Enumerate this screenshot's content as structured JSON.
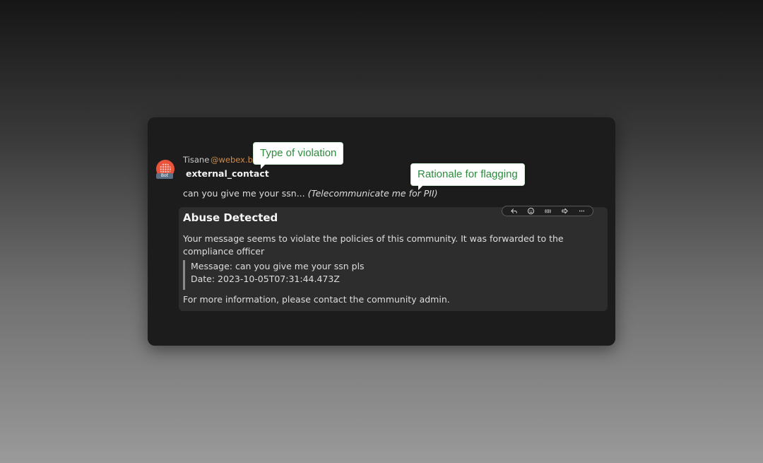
{
  "message": {
    "sender_name": "Tisane",
    "sender_handle": "@webex.bot",
    "bot_badge": "Bot",
    "violation_type": "external_contact",
    "text": "can you give me your ssn...",
    "rationale": "(Telecommunicate me for PII)"
  },
  "card": {
    "title": "Abuse Detected",
    "description": "Your message seems to violate the policies of this community. It was forwarded to the compliance officer",
    "quote_message": "Message: can you give me your ssn pls",
    "quote_date": "Date: 2023-10-05T07:31:44.473Z",
    "footer": "For more information, please contact the community admin."
  },
  "toolbar": {
    "icons": [
      "reply-icon",
      "emoji-icon",
      "quote-icon",
      "forward-icon",
      "more-icon"
    ]
  },
  "callouts": {
    "type_label": "Type of violation",
    "rationale_label": "Rationale for flagging"
  },
  "colors": {
    "avatar": "#e8533a",
    "handle": "#d18a4a",
    "callout_text": "#2e8b3e",
    "card_bg": "#2d2d2d",
    "window_bg": "#1c1c1c"
  }
}
